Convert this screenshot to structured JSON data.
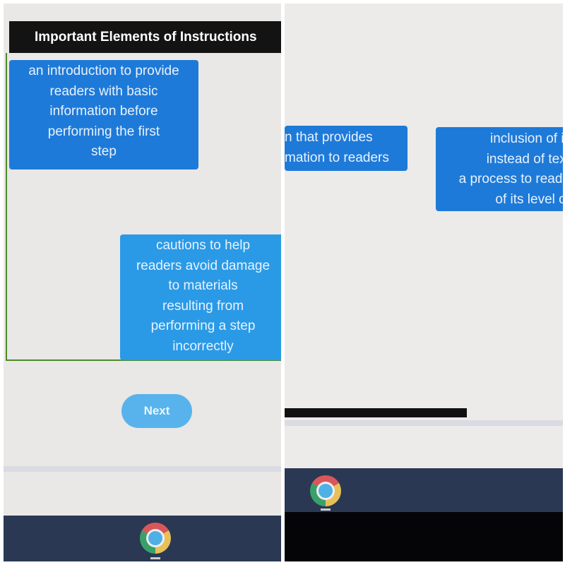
{
  "left_panel": {
    "title": "Important Elements of Instructions",
    "cards": [
      "an introduction to provide readers with basic information before performing the first step",
      "cautions to help readers avoid damage to materials resulting from performing a step incorrectly"
    ],
    "card_lines": [
      [
        "an introduction to provide",
        "readers with basic",
        "information before",
        "performing the first",
        "step"
      ],
      [
        "cautions to help",
        "readers avoid damage",
        "to materials",
        "resulting from",
        "performing a step",
        "incorrectly"
      ]
    ],
    "next_label": "Next",
    "taskbar_icon": "chrome-icon"
  },
  "right_panel": {
    "card_lines": [
      [
        "n that provides",
        "mation to readers"
      ],
      [
        "inclusion of ill",
        "instead of text",
        "a process to reade",
        "of its level of"
      ]
    ],
    "taskbar_icon": "chrome-icon"
  },
  "colors": {
    "card_dark": "#1e7ad8",
    "card_light": "#2a9ae6",
    "title_bar": "#131313",
    "taskbar": "#2a3854",
    "next_button": "#58b3ec"
  }
}
